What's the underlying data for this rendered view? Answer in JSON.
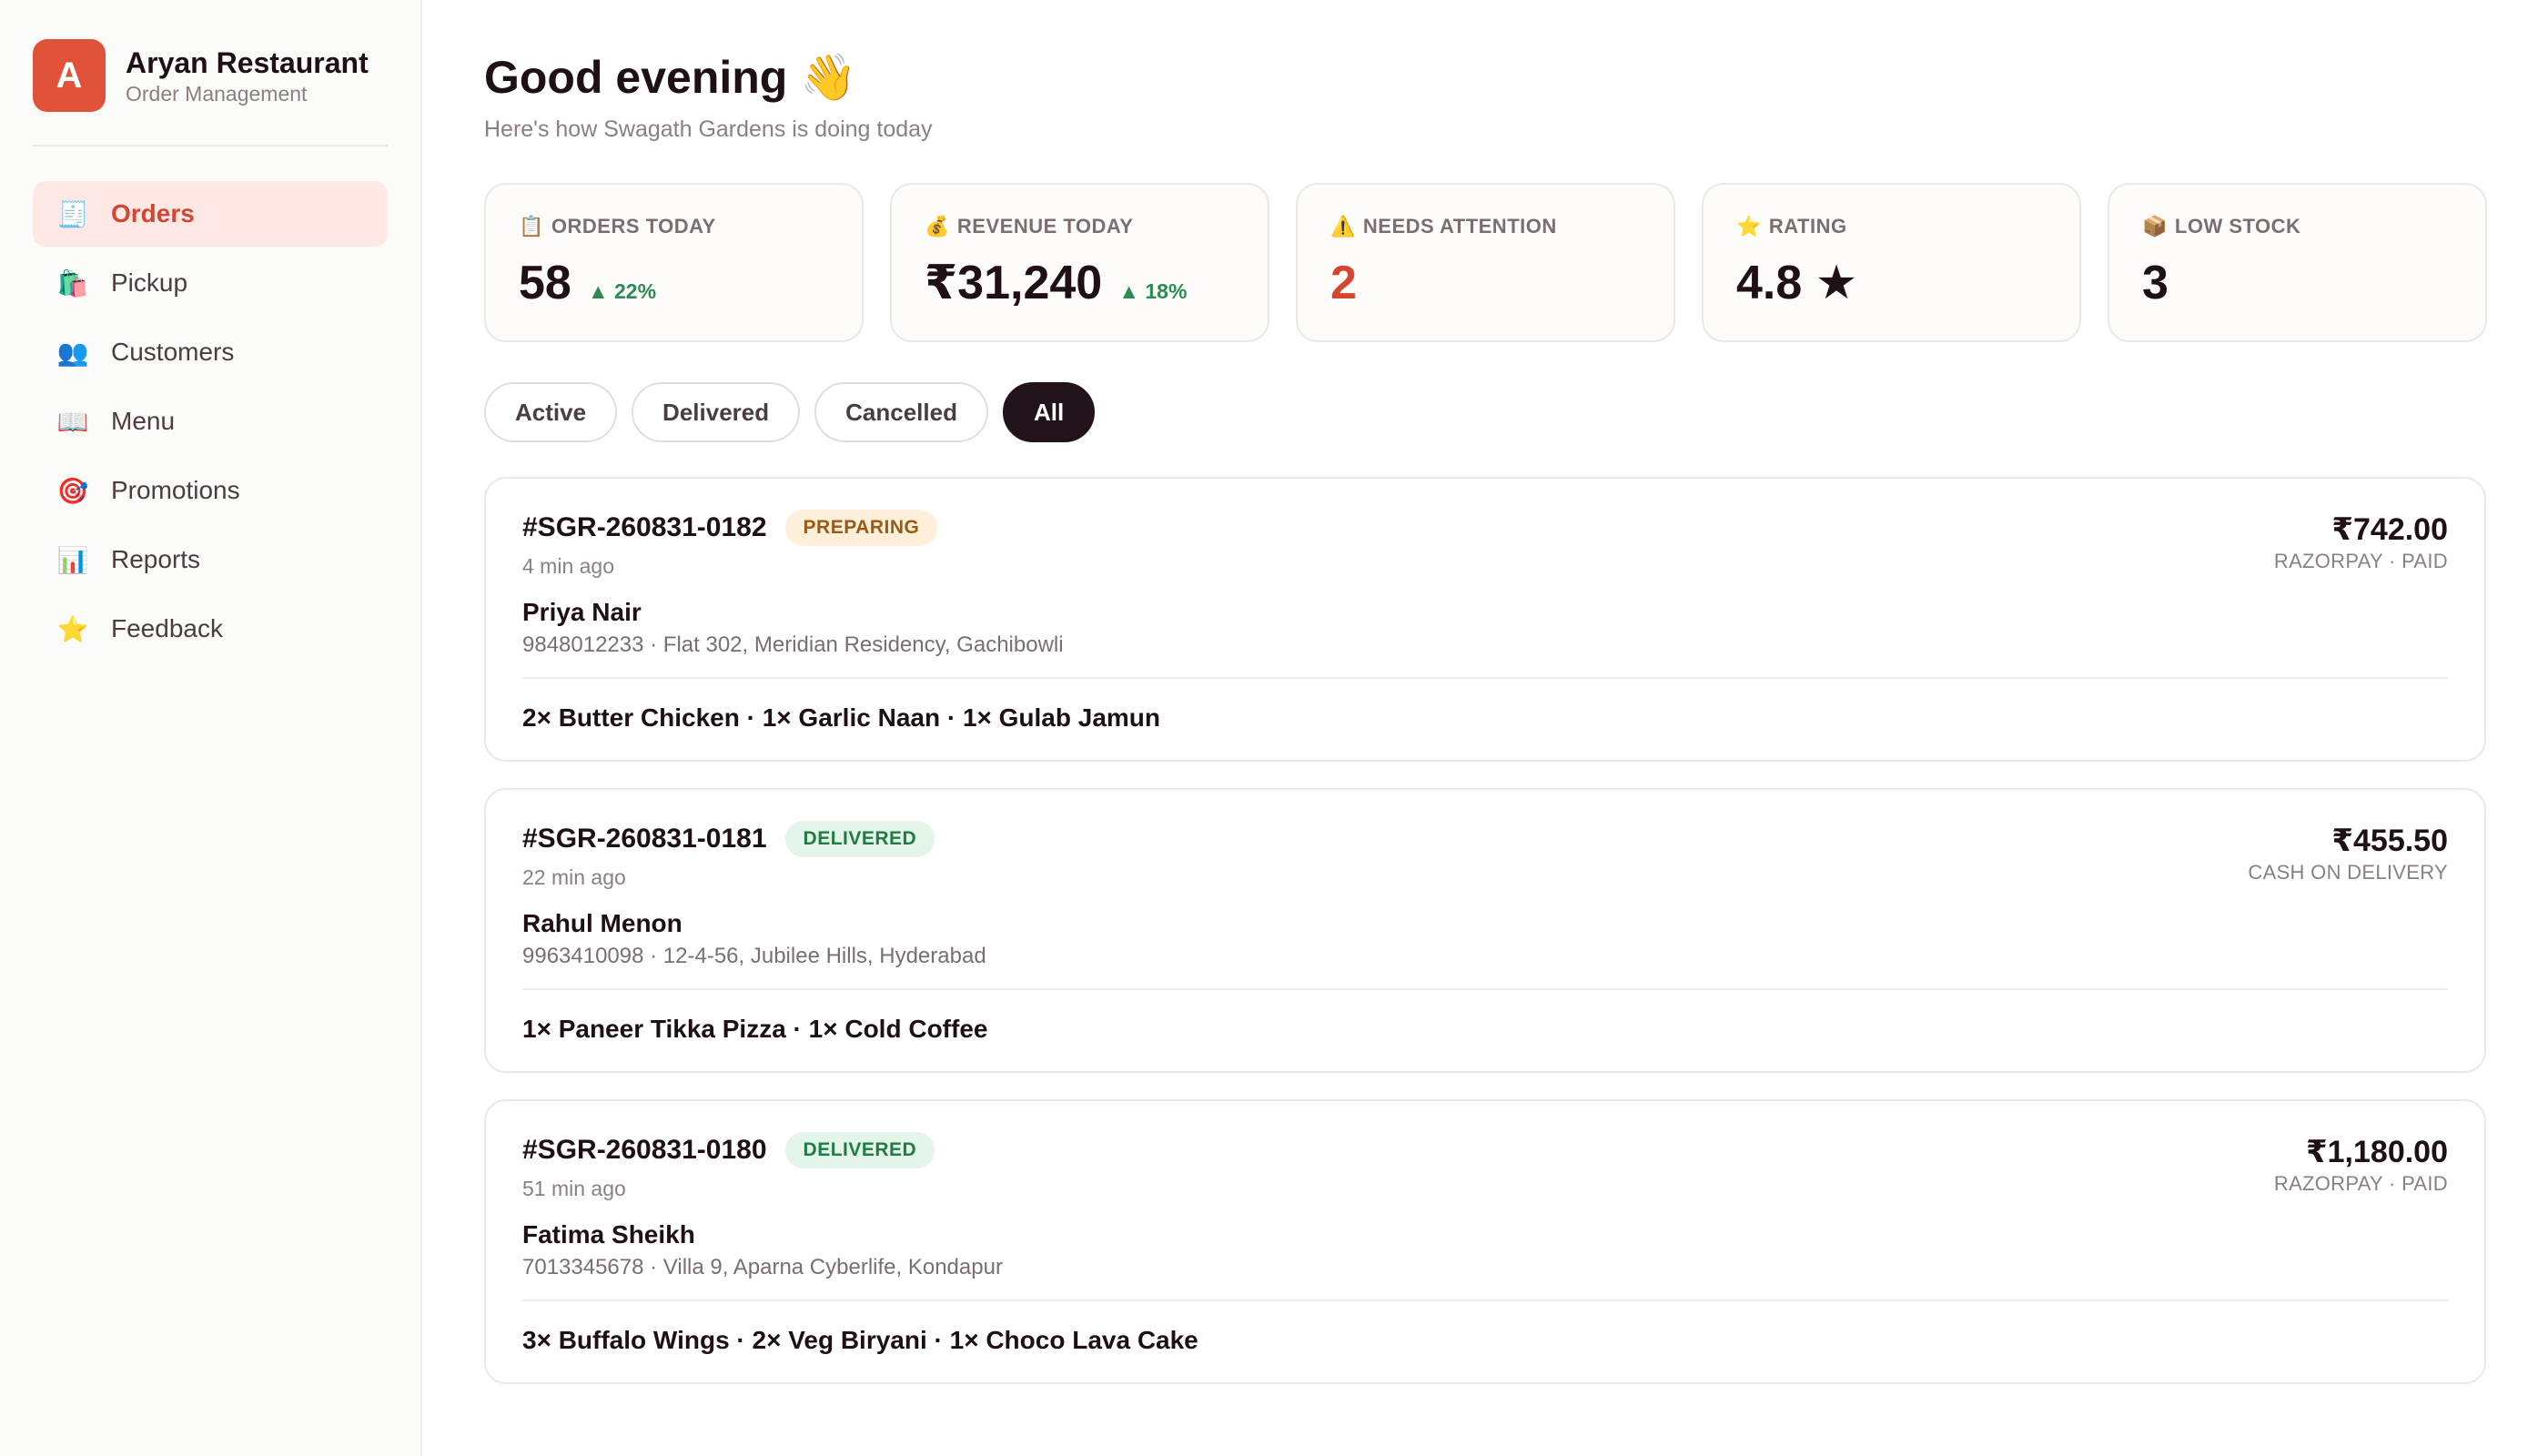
{
  "brand": {
    "logo_letter": "A",
    "name": "Aryan Restaurant",
    "subtitle": "Order Management",
    "color": "#e0533a"
  },
  "sidebar": {
    "items": [
      {
        "label": "Orders",
        "icon": "🧾",
        "icon_name": "receipt-icon",
        "active": true
      },
      {
        "label": "Pickup",
        "icon": "🛍️",
        "icon_name": "shopping-bags-icon",
        "active": false
      },
      {
        "label": "Customers",
        "icon": "👥",
        "icon_name": "people-icon",
        "active": false
      },
      {
        "label": "Menu",
        "icon": "📖",
        "icon_name": "book-icon",
        "active": false
      },
      {
        "label": "Promotions",
        "icon": "🎯",
        "icon_name": "target-icon",
        "active": false
      },
      {
        "label": "Reports",
        "icon": "📊",
        "icon_name": "bar-chart-icon",
        "active": false
      },
      {
        "label": "Feedback",
        "icon": "⭐",
        "icon_name": "star-icon",
        "active": false
      }
    ]
  },
  "header": {
    "greeting": "Good evening 👋",
    "subtitle": "Here's how Swagath Gardens is doing today"
  },
  "stats": [
    {
      "icon": "📋",
      "icon_name": "clipboard-icon",
      "label": "ORDERS TODAY",
      "value": "58",
      "delta": "▲ 22%"
    },
    {
      "icon": "💰",
      "icon_name": "money-bag-icon",
      "label": "REVENUE TODAY",
      "value": "₹31,240",
      "delta": "▲ 18%"
    },
    {
      "icon": "⚠️",
      "icon_name": "warning-icon",
      "label": "NEEDS ATTENTION",
      "value": "2",
      "delta": ""
    },
    {
      "icon": "⭐",
      "icon_name": "star-icon",
      "label": "RATING",
      "value": "4.8 ★",
      "delta": ""
    },
    {
      "icon": "📦",
      "icon_name": "package-icon",
      "label": "LOW STOCK",
      "value": "3",
      "delta": ""
    }
  ],
  "filters": [
    {
      "label": "Active",
      "selected": false
    },
    {
      "label": "Delivered",
      "selected": false
    },
    {
      "label": "Cancelled",
      "selected": false
    },
    {
      "label": "All",
      "selected": true
    }
  ],
  "orders": [
    {
      "id": "#SGR-260831-0182",
      "status": "PREPARING",
      "time": "4 min ago",
      "amount": "₹742.00",
      "payment": "RAZORPAY · PAID",
      "customer": "Priya Nair",
      "meta": "9848012233 · Flat 302, Meridian Residency, Gachibowli",
      "items": "2× Butter Chicken · 1× Garlic Naan · 1× Gulab Jamun"
    },
    {
      "id": "#SGR-260831-0181",
      "status": "DELIVERED",
      "time": "22 min ago",
      "amount": "₹455.50",
      "payment": "CASH ON DELIVERY",
      "customer": "Rahul Menon",
      "meta": "9963410098 · 12-4-56, Jubilee Hills, Hyderabad",
      "items": "1× Paneer Tikka Pizza · 1× Cold Coffee"
    },
    {
      "id": "#SGR-260831-0180",
      "status": "DELIVERED",
      "time": "51 min ago",
      "amount": "₹1,180.00",
      "payment": "RAZORPAY · PAID",
      "customer": "Fatima Sheikh",
      "meta": "7013345678 · Villa 9, Aparna Cyberlife, Kondapur",
      "items": "3× Buffalo Wings · 2× Veg Biryani · 1× Choco Lava Cake"
    }
  ]
}
